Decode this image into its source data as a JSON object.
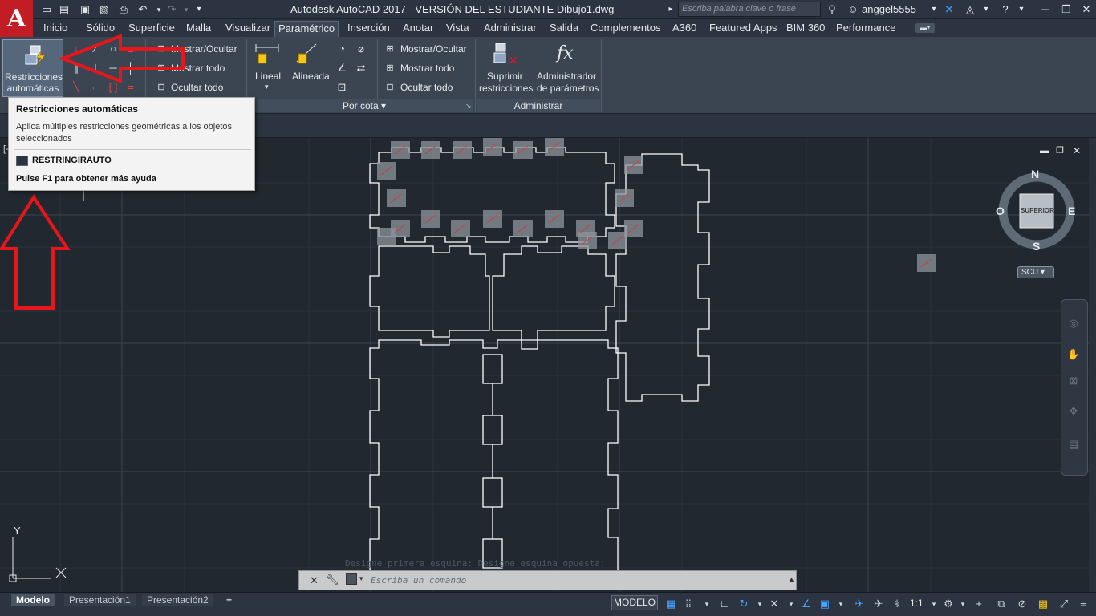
{
  "title_bar": {
    "title": "Autodesk AutoCAD 2017 - VERSIÓN DEL ESTUDIANTE    Dibujo1.dwg",
    "search_placeholder": "Escriba palabra clave o frase",
    "user": "anggel5555",
    "logo": "A"
  },
  "menu_tabs": [
    "Inicio",
    "Sólido",
    "Superficie",
    "Malla",
    "Visualizar",
    "Paramétrico",
    "Inserción",
    "Anotar",
    "Vista",
    "Administrar",
    "Salida",
    "Complementos",
    "A360",
    "Featured Apps",
    "BIM 360",
    "Performance"
  ],
  "active_tab": "Paramétrico",
  "ribbon": {
    "auto_constrain_line1": "Restricciones",
    "auto_constrain_line2": "automáticas",
    "geom_show_hide": "Mostrar/Ocultar",
    "geom_show_all": "Mostrar todo",
    "geom_hide_all": "Ocultar todo",
    "dim_linear": "Lineal",
    "dim_aligned": "Alineada",
    "dim_show_hide": "Mostrar/Ocultar",
    "dim_show_all": "Mostrar todo",
    "dim_hide_all": "Ocultar todo",
    "dim_panel_title": "Por cota",
    "delete_line1": "Suprimir",
    "delete_line2": "restricciones",
    "params_line1": "Administrador",
    "params_line2": "de parámetros",
    "manage_panel_title": "Administrar"
  },
  "tooltip": {
    "title": "Restricciones automáticas",
    "description": "Aplica múltiples restricciones geométricas a los objetos seleccionados",
    "command": "RESTRINGIRAUTO",
    "help": "Pulse F1 para obtener más ayuda"
  },
  "viewcube": {
    "north": "N",
    "south": "S",
    "east": "E",
    "west": "O",
    "face": "SUPERIOR",
    "ucs": "SCU"
  },
  "command": {
    "history": "Designe primera esquina: Designe esquina opuesta:",
    "placeholder": "Escriba un comando"
  },
  "status": {
    "tabs": [
      "Modelo",
      "Presentación1",
      "Presentación2"
    ],
    "add_tab": "+",
    "model_label": "MODELO",
    "scale": "1:1"
  },
  "ucs_axes": {
    "y": "Y",
    "x": "X"
  },
  "colors": {
    "accent_red": "#e8161b",
    "canvas_bg": "#212830",
    "ribbon_bg": "#3b4552",
    "logo_red": "#c21c24"
  }
}
